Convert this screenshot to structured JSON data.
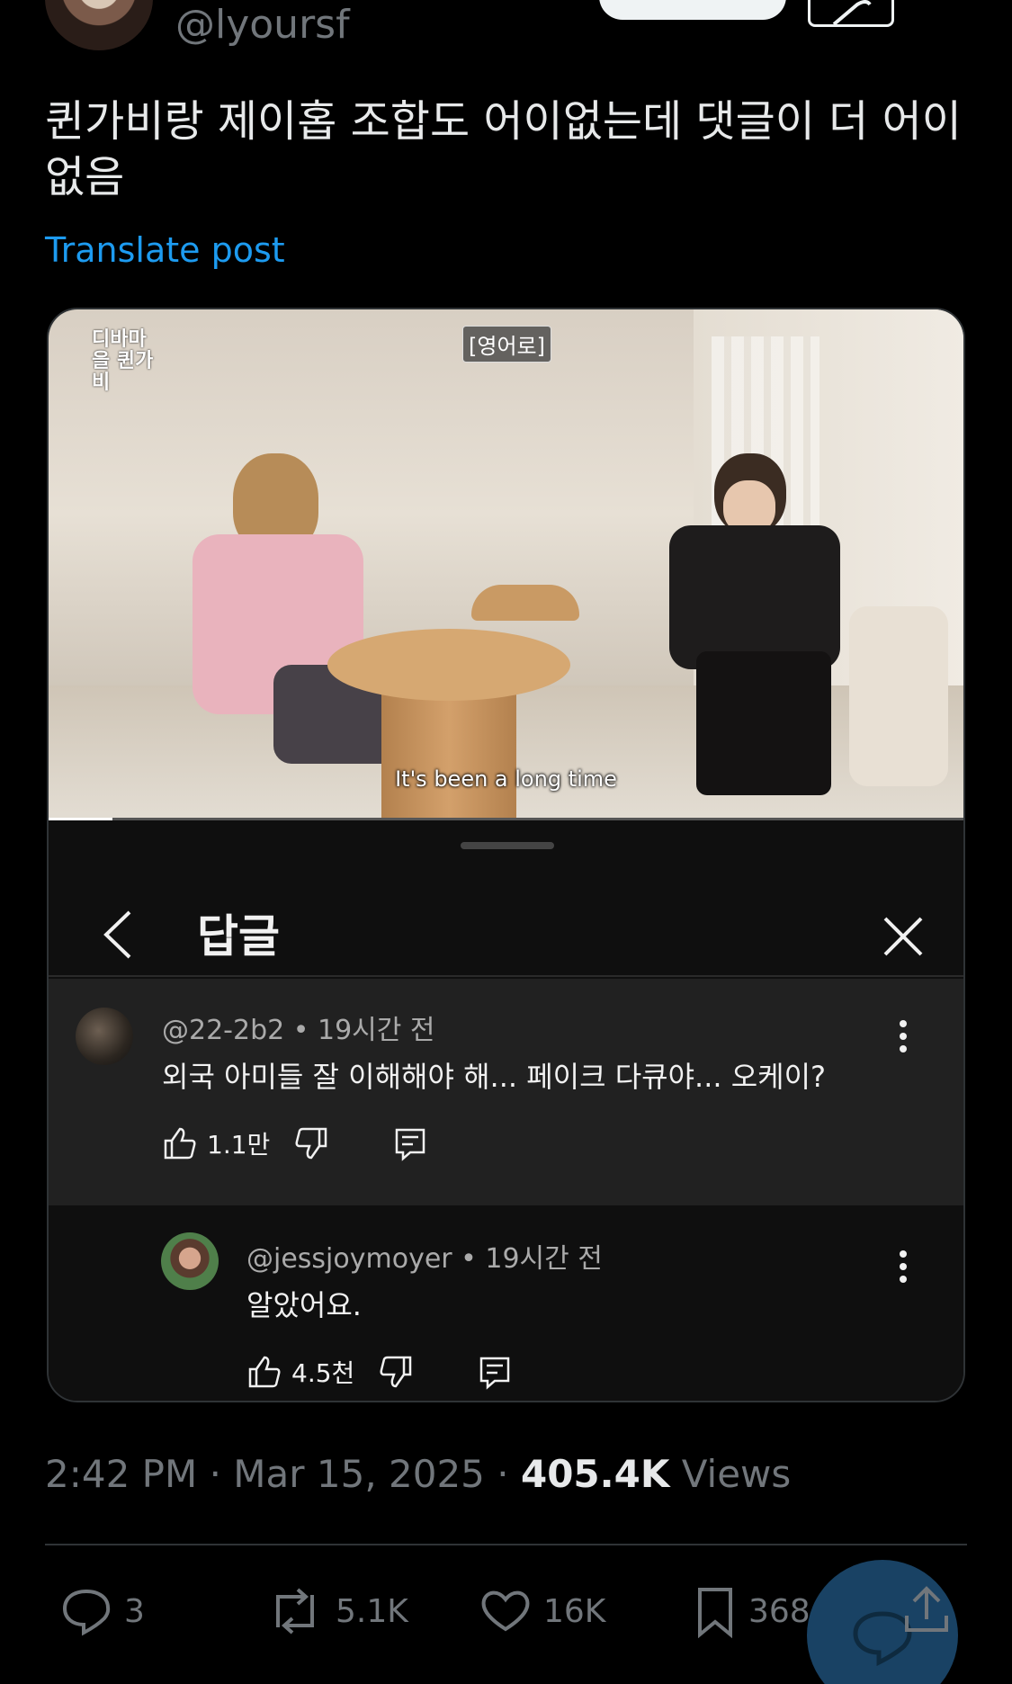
{
  "author": {
    "handle": "@lyoursf"
  },
  "post": {
    "text": "퀸가비랑 제이홉 조합도 어이없는데 댓글이 더 어이없음",
    "translate_label": "Translate post"
  },
  "video": {
    "logo_text": "디바마을 퀸가비",
    "tag": "[영어로]",
    "subtitle": "It's been a long time",
    "progress_fraction": 0.07
  },
  "sheet": {
    "title": "답글",
    "comments": [
      {
        "author": "@22-2b2",
        "time": "19시간 전",
        "meta": "@22-2b2 • 19시간 전",
        "text": "외국 아미들 잘 이해해야 해... 페이크 다큐야... 오케이?",
        "likes": "1.1만"
      },
      {
        "author": "@jessjoymoyer",
        "time": "19시간 전",
        "meta": "@jessjoymoyer • 19시간 전",
        "text": "알았어요.",
        "likes": "4.5천"
      }
    ]
  },
  "meta": {
    "time": "2:42 PM · Mar 15, 2025 · ",
    "views_count": "405.4K",
    "views_label": " Views"
  },
  "actions": {
    "replies": "3",
    "reposts": "5.1K",
    "likes": "16K",
    "bookmarks": "368"
  },
  "colors": {
    "accent": "#1d9bf0",
    "background": "#000000",
    "muted": "#71767b"
  }
}
